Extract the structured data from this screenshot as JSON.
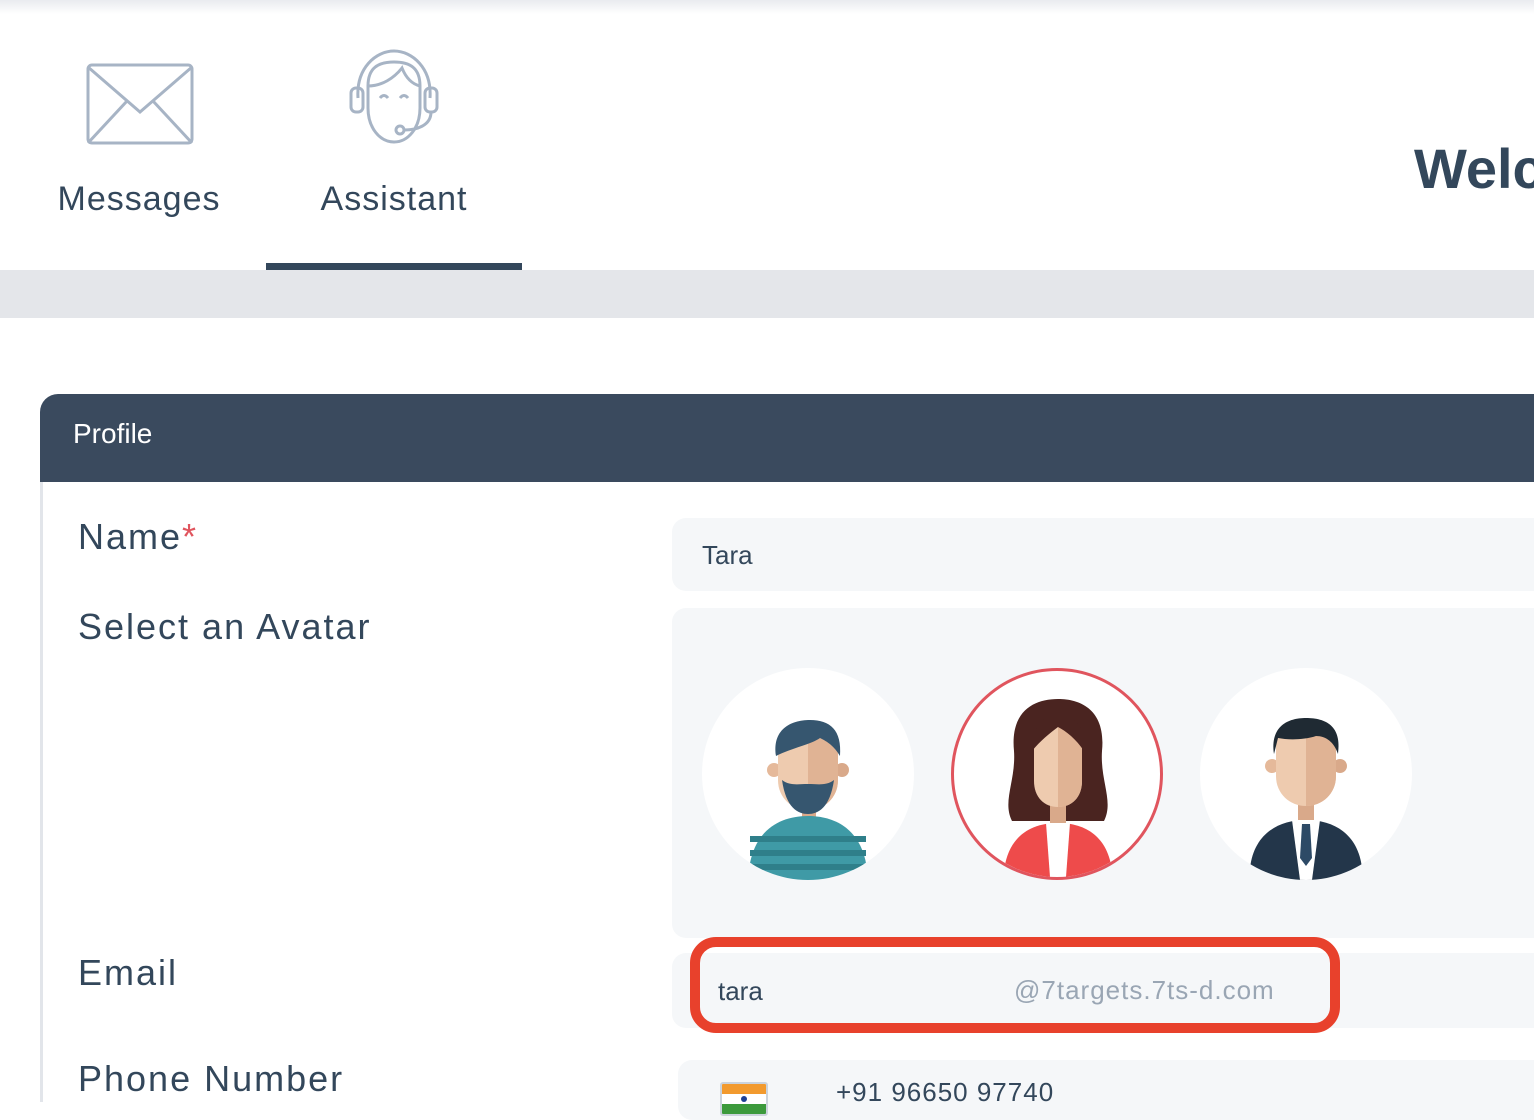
{
  "nav": {
    "tabs": [
      {
        "label": "Messages",
        "icon": "mail-icon"
      },
      {
        "label": "Assistant",
        "icon": "headset-icon",
        "active": true
      }
    ],
    "welcome": "Welc"
  },
  "profile": {
    "title": "Profile",
    "name_label": "Name",
    "required_mark": "*",
    "name_value": "Tara",
    "avatar_label": "Select an Avatar",
    "avatars": [
      {
        "name": "bearded-man-avatar",
        "selected": false
      },
      {
        "name": "woman-avatar",
        "selected": true
      },
      {
        "name": "businessman-avatar",
        "selected": false
      }
    ],
    "email_label": "Email",
    "email_user": "tara",
    "email_domain": "@7targets.7ts-d.com",
    "phone_label": "Phone Number",
    "phone_value": "+91 96650 97740"
  },
  "colors": {
    "header_bg": "#3a4a5e",
    "text": "#33475b",
    "highlight": "#e8412c",
    "selected_ring": "#e0555e"
  }
}
